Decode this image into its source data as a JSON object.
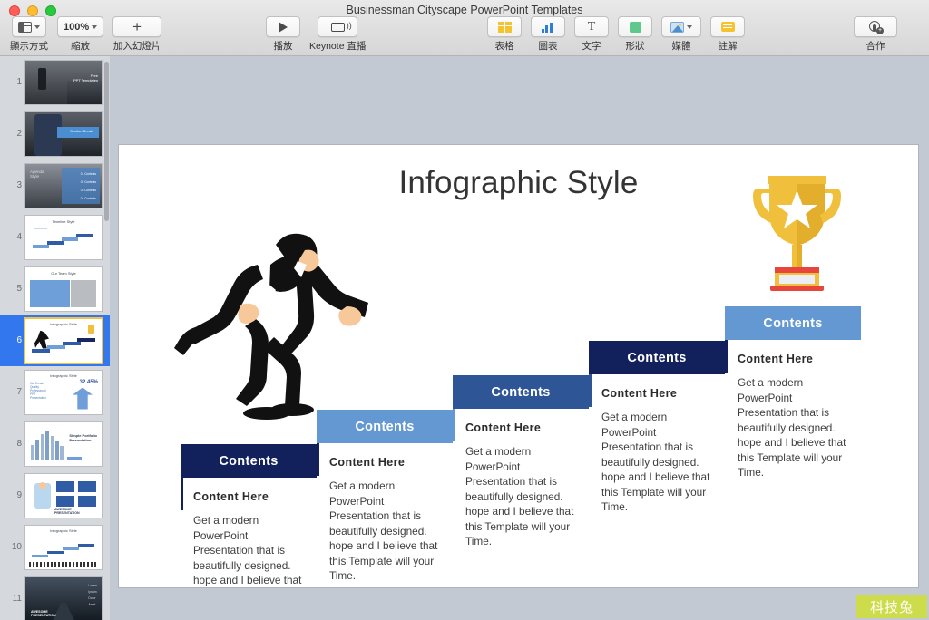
{
  "window": {
    "title": "Businessman Cityscape PowerPoint Templates",
    "traffic_lights": [
      "close",
      "minimize",
      "zoom"
    ]
  },
  "toolbar": {
    "left_items": [
      {
        "name": "view-mode",
        "label": "顯示方式",
        "icon": "layout-icon",
        "has_caret": true
      },
      {
        "name": "zoom",
        "label": "縮放",
        "value": "100%",
        "icon": "zoom-value",
        "has_caret": true
      },
      {
        "name": "add-slide",
        "label": "加入幻燈片",
        "icon": "plus-icon",
        "has_caret": false
      }
    ],
    "play_items": [
      {
        "name": "play",
        "label": "播放",
        "icon": "play-icon",
        "has_caret": false
      },
      {
        "name": "keynote-live",
        "label": "Keynote 直播",
        "icon": "cast-icon",
        "has_caret": false
      }
    ],
    "insert_items": [
      {
        "name": "table",
        "label": "表格",
        "icon": "table-icon",
        "has_caret": false
      },
      {
        "name": "chart",
        "label": "圖表",
        "icon": "chart-icon",
        "has_caret": false
      },
      {
        "name": "text",
        "label": "文字",
        "icon": "text-icon",
        "has_caret": false
      },
      {
        "name": "shape",
        "label": "形狀",
        "icon": "shape-icon",
        "has_caret": false
      },
      {
        "name": "media",
        "label": "媒體",
        "icon": "media-icon",
        "has_caret": true
      },
      {
        "name": "comment",
        "label": "註解",
        "icon": "comment-icon",
        "has_caret": false
      }
    ],
    "right_items": [
      {
        "name": "collaborate",
        "label": "合作",
        "icon": "collaborate-icon",
        "has_caret": false
      }
    ]
  },
  "sidebar": {
    "slides": [
      {
        "number": "1",
        "kind": "photo-dark-city",
        "title": "Free PPT Templates"
      },
      {
        "number": "2",
        "kind": "photo-portrait",
        "title": "Section Break"
      },
      {
        "number": "3",
        "kind": "photo-agenda",
        "title": "Agenda Style"
      },
      {
        "number": "4",
        "kind": "timeline",
        "title": "Timeline Style"
      },
      {
        "number": "5",
        "kind": "team",
        "title": "Our Team Style"
      },
      {
        "number": "6",
        "kind": "infographic-stairs",
        "title": "Infographic Style"
      },
      {
        "number": "7",
        "kind": "infographic-arrow",
        "title": "Infographic Style"
      },
      {
        "number": "8",
        "kind": "portfolio-bars",
        "title": "Simple Portfolio Presentation"
      },
      {
        "number": "9",
        "kind": "awesome-person",
        "title": "AWESOME PRESENTATION"
      },
      {
        "number": "10",
        "kind": "infographic-steps",
        "title": "Infographic Style"
      },
      {
        "number": "11",
        "kind": "photo-street",
        "title": "AWESOME PRESENTATION"
      }
    ],
    "selected_index": 5
  },
  "slide": {
    "title": "Infographic Style",
    "runner_alt": "running-businessman-silhouette",
    "trophy_alt": "gold-trophy-with-star",
    "steps": [
      {
        "header": "Contents",
        "subheading": "Content  Here",
        "body": "Get a modern PowerPoint  Presentation that is beautifully designed. hope and I believe that this Template will your Time.",
        "header_color": "#12205c",
        "rule_color": "#12205c"
      },
      {
        "header": "Contents",
        "subheading": "Content  Here",
        "body": "Get a modern PowerPoint  Presentation that is beautifully designed. hope and I believe that this Template will your Time.",
        "header_color": "#6398d2",
        "rule_color": "#12205c"
      },
      {
        "header": "Contents",
        "subheading": "Content  Here",
        "body": "Get a modern PowerPoint Presentation that is beautifully designed. hope and I believe that this Template will your Time.",
        "header_color": "#2e5596",
        "rule_color": "#6398d2"
      },
      {
        "header": "Contents",
        "subheading": "Content  Here",
        "body": "Get a modern PowerPoint Presentation that is beautifully designed. hope and I believe that this Template will your Time.",
        "header_color": "#12205c",
        "rule_color": "#2e5596"
      },
      {
        "header": "Contents",
        "subheading": "Content  Here",
        "body": "Get a modern PowerPoint Presentation that is beautifully designed. hope and I believe that this Template will your Time.",
        "header_color": "#6398d2",
        "rule_color": "#12205c"
      }
    ]
  },
  "watermark": {
    "text": "科技兔",
    "color": "#cddc4b"
  },
  "colors": {
    "dark_navy": "#12205c",
    "mid_blue": "#2e5596",
    "light_blue": "#6398d2",
    "canvas_bg": "#c3c9d2",
    "sidebar_bg": "#d5d8dc",
    "selection_blue": "#3377ee",
    "selection_border": "#f5c33b",
    "trophy_gold": "#f0c03c",
    "trophy_red": "#e8453c"
  }
}
